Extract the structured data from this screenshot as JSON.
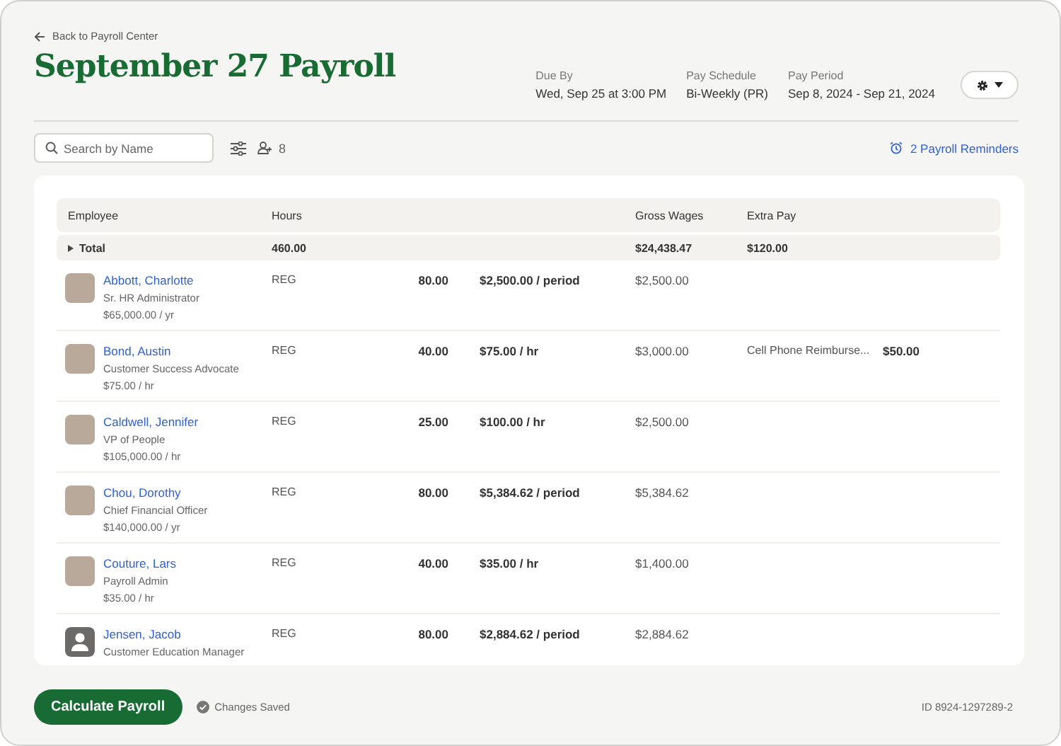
{
  "back_link": "Back to Payroll Center",
  "title": "September 27 Payroll",
  "meta": [
    {
      "label": "Due By",
      "value": "Wed, Sep 25 at 3:00 PM"
    },
    {
      "label": "Pay Schedule",
      "value": "Bi-Weekly (PR)"
    },
    {
      "label": "Pay Period",
      "value": "Sep 8, 2024 - Sep 21, 2024"
    }
  ],
  "toolbar": {
    "search": {
      "placeholder": "Search by Name"
    },
    "employee_count": "8",
    "reminders": "2 Payroll Reminders"
  },
  "table": {
    "columns": [
      "Employee",
      "Hours",
      "Gross Wages",
      "Extra Pay"
    ],
    "total": {
      "label": "Total",
      "expanded": false,
      "hours": "460.00",
      "gross_wages": "$24,438.47",
      "extra_pay": "$120.00"
    },
    "rows": [
      {
        "name": "Abbott, Charlotte",
        "job_title": "Sr. HR Administrator",
        "salary": "$65,000.00 / yr",
        "avatar": {
          "kind": "photo"
        },
        "pay_type": "REG",
        "hours": "80.00",
        "rate": "$2,500.00 / period",
        "gross_wages": "$2,500.00"
      },
      {
        "name": "Bond, Austin",
        "job_title": "Customer Success Advocate",
        "salary": "$75.00 / hr",
        "avatar": {
          "kind": "photo"
        },
        "pay_type": "REG",
        "hours": "40.00",
        "rate": "$75.00 / hr",
        "gross_wages": "$3,000.00",
        "extra_pay_label": "Cell Phone Reimburse...",
        "extra_pay_amount": "$50.00"
      },
      {
        "name": "Caldwell, Jennifer",
        "job_title": "VP of People",
        "salary": "$105,000.00 / hr",
        "avatar": {
          "kind": "photo"
        },
        "pay_type": "REG",
        "hours": "25.00",
        "rate": "$100.00 / hr",
        "gross_wages": "$2,500.00"
      },
      {
        "name": "Chou, Dorothy",
        "job_title": "Chief Financial Officer",
        "salary": "$140,000.00 / yr",
        "avatar": {
          "kind": "photo"
        },
        "pay_type": "REG",
        "hours": "80.00",
        "rate": "$5,384.62 / period",
        "gross_wages": "$5,384.62"
      },
      {
        "name": "Couture, Lars",
        "job_title": "Payroll Admin",
        "salary": "$35.00 / hr",
        "avatar": {
          "kind": "photo"
        },
        "pay_type": "REG",
        "hours": "40.00",
        "rate": "$35.00 / hr",
        "gross_wages": "$1,400.00"
      },
      {
        "name": "Jensen, Jacob",
        "job_title": "Customer Education Manager",
        "avatar": {
          "kind": "silhouette"
        },
        "pay_type": "REG",
        "hours": "80.00",
        "rate": "$2,884.62 / period",
        "gross_wages": "$2,884.62"
      }
    ]
  },
  "footer": {
    "button": "Calculate Payroll",
    "status": "Changes Saved",
    "id": "ID 8924-1297289-2"
  }
}
